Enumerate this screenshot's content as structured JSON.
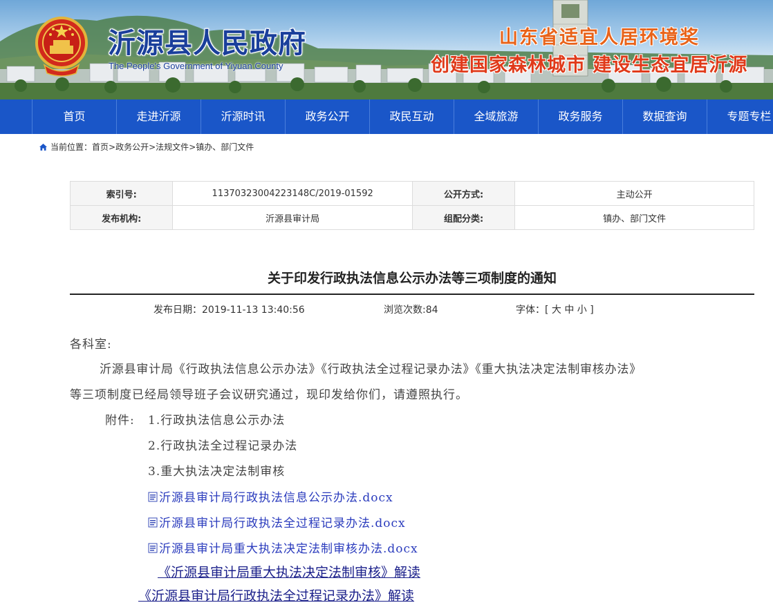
{
  "header": {
    "title": "沂源县人民政府",
    "subtitle": "The People's Government of Yiyuan County",
    "slogan_1": "山东省适宜人居环境奖",
    "slogan_2": "创建国家森林城市  建设生态宜居沂源"
  },
  "nav": {
    "items": [
      "首页",
      "走进沂源",
      "沂源时讯",
      "政务公开",
      "政民互动",
      "全域旅游",
      "政务服务",
      "数据查询",
      "专题专栏"
    ]
  },
  "breadcrumb": {
    "prefix": "当前位置：",
    "items": [
      "首页",
      "政务公开",
      "法规文件",
      "镇办、部门文件"
    ],
    "separator": ">"
  },
  "info_table": {
    "index_label": "索引号:",
    "index_value": "11370323004223148C/2019-01592",
    "publish_method_label": "公开方式:",
    "publish_method_value": "主动公开",
    "issuer_label": "发布机构:",
    "issuer_value": "沂源县审计局",
    "category_label": "组配分类:",
    "category_value": "镇办、部门文件"
  },
  "article": {
    "title": "关于印发行政执法信息公示办法等三项制度的通知",
    "date_text": "发布日期：2019-11-13 13:40:56",
    "views_text": "浏览次数:84",
    "font_size_label": "字体：[ 大 中 小 ]",
    "salutation": "各科室:",
    "para_line1": "沂源县审计局《行政执法信息公示办法》《行政执法全过程记录办法》《重大执法决定法制审核办法》",
    "para_line2": "等三项制度已经局领导班子会议研究通过，现印发给你们，请遵照执行。",
    "attach_prefix": "附件: ",
    "attach_items": [
      "1.行政执法信息公示办法",
      "2.行政执法全过程记录办法",
      "3.重大执法决定法制审核"
    ],
    "files": [
      "沂源县审计局行政执法信息公示办法.docx",
      "沂源县审计局行政执法全过程记录办法.docx",
      "沂源县审计局重大执法决定法制审核办法.docx"
    ],
    "interpretations": [
      "《沂源县审计局重大执法决定法制审核》解读",
      "《沂源县审计局行政执法全过程记录办法》解读"
    ]
  },
  "colors": {
    "nav_bg": "#1a56c8",
    "title_blue": "#1a3f9b",
    "slogan_orange": "#e8631a",
    "link_blue": "#2a3bbd"
  }
}
